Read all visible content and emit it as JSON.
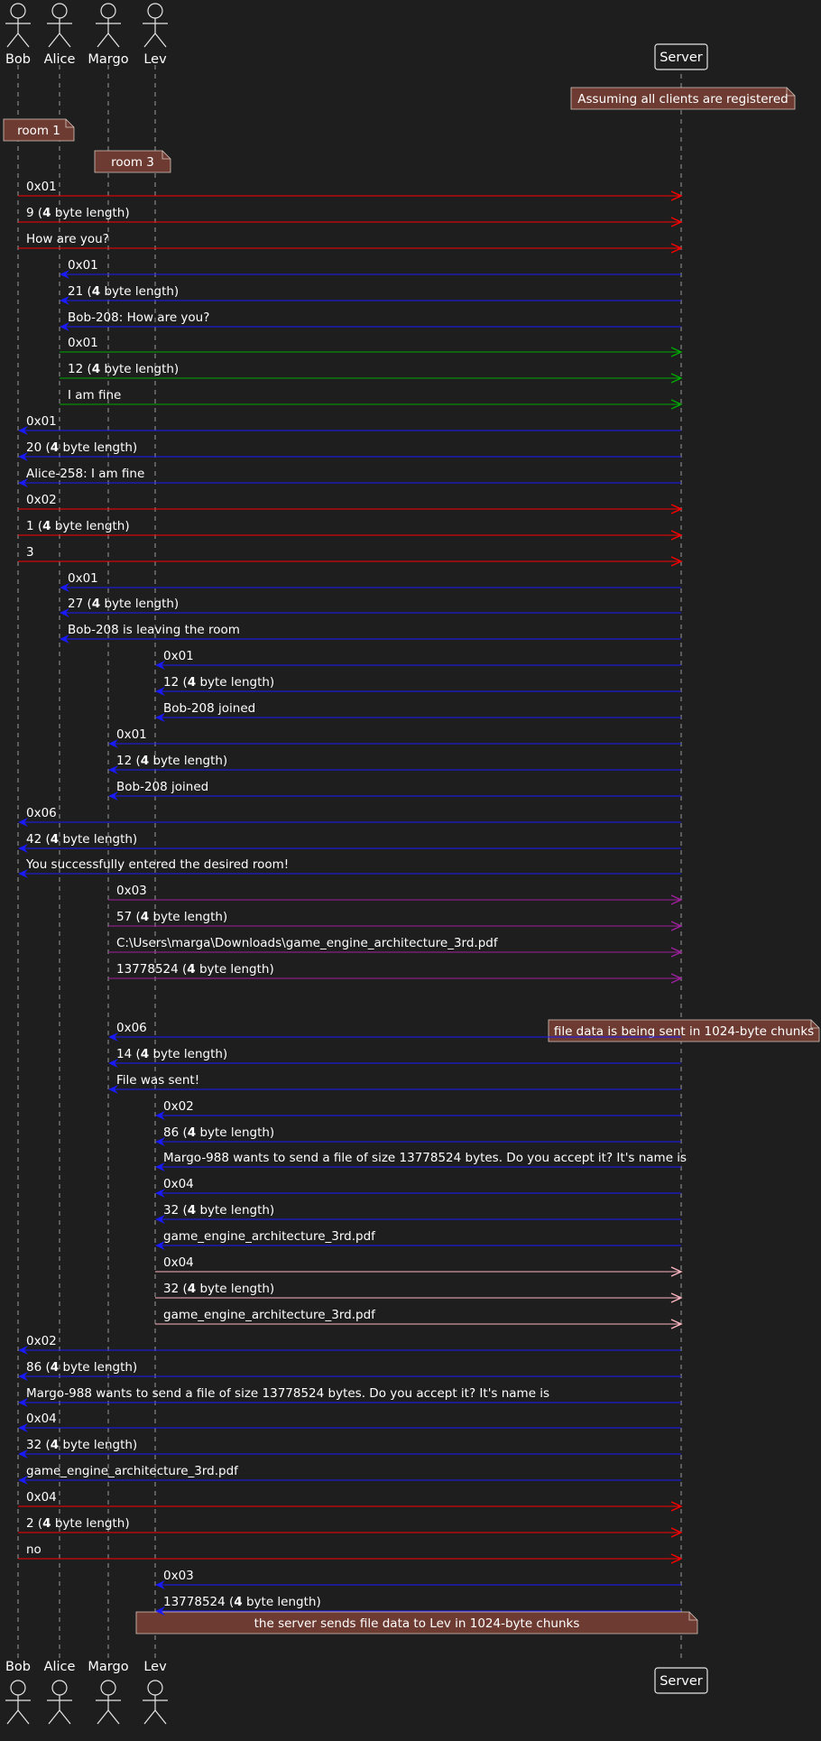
{
  "participants": [
    {
      "id": "bob",
      "name": "Bob",
      "kind": "actor"
    },
    {
      "id": "alice",
      "name": "Alice",
      "kind": "actor"
    },
    {
      "id": "margo",
      "name": "Margo",
      "kind": "actor"
    },
    {
      "id": "lev",
      "name": "Lev",
      "kind": "actor"
    },
    {
      "id": "server",
      "name": "Server",
      "kind": "box"
    }
  ],
  "colors": {
    "background": "#1e1e1e",
    "lifeline": "#9a9a9a",
    "note_fill": "#6e3b32",
    "bob": "#ff0000",
    "alice": "#00aa00",
    "margo": "#a020a0",
    "lev": "#ffb6c1",
    "server": "#1a1aff"
  },
  "notes": [
    {
      "text": "Assuming all clients are registered",
      "over": "server",
      "after": -1
    },
    {
      "text": "room 1",
      "over": "bob",
      "after": -1
    },
    {
      "text": "room 3",
      "over": "margo",
      "after": -1
    },
    {
      "text": "file data is being sent in 1024-byte chunks",
      "over": "server",
      "after": 32
    },
    {
      "text": "the server sends file data to Lev in 1024-byte chunks",
      "over": "margo-server",
      "after": 59
    }
  ],
  "messages": [
    {
      "from": "bob",
      "to": "server",
      "text": "0x01"
    },
    {
      "from": "bob",
      "to": "server",
      "text": "9 (",
      "bold": "4",
      "suffix": " byte length)"
    },
    {
      "from": "bob",
      "to": "server",
      "text": "How are you?"
    },
    {
      "from": "server",
      "to": "alice",
      "text": "0x01"
    },
    {
      "from": "server",
      "to": "alice",
      "text": "21 (",
      "bold": "4",
      "suffix": " byte length)"
    },
    {
      "from": "server",
      "to": "alice",
      "text": "Bob-208: How are you?"
    },
    {
      "from": "alice",
      "to": "server",
      "text": "0x01"
    },
    {
      "from": "alice",
      "to": "server",
      "text": "12 (",
      "bold": "4",
      "suffix": " byte length)"
    },
    {
      "from": "alice",
      "to": "server",
      "text": "I am fine"
    },
    {
      "from": "server",
      "to": "bob",
      "text": "0x01"
    },
    {
      "from": "server",
      "to": "bob",
      "text": "20 (",
      "bold": "4",
      "suffix": " byte length)"
    },
    {
      "from": "server",
      "to": "bob",
      "text": "Alice-258: I am fine"
    },
    {
      "from": "bob",
      "to": "server",
      "text": "0x02"
    },
    {
      "from": "bob",
      "to": "server",
      "text": "1 (",
      "bold": "4",
      "suffix": " byte length)"
    },
    {
      "from": "bob",
      "to": "server",
      "text": "3"
    },
    {
      "from": "server",
      "to": "alice",
      "text": "0x01"
    },
    {
      "from": "server",
      "to": "alice",
      "text": "27 (",
      "bold": "4",
      "suffix": " byte length)"
    },
    {
      "from": "server",
      "to": "alice",
      "text": "Bob-208 is leaving the room"
    },
    {
      "from": "server",
      "to": "lev",
      "text": "0x01"
    },
    {
      "from": "server",
      "to": "lev",
      "text": "12 (",
      "bold": "4",
      "suffix": " byte length)"
    },
    {
      "from": "server",
      "to": "lev",
      "text": "Bob-208 joined"
    },
    {
      "from": "server",
      "to": "margo",
      "text": "0x01"
    },
    {
      "from": "server",
      "to": "margo",
      "text": "12 (",
      "bold": "4",
      "suffix": " byte length)"
    },
    {
      "from": "server",
      "to": "margo",
      "text": "Bob-208 joined"
    },
    {
      "from": "server",
      "to": "bob",
      "text": "0x06"
    },
    {
      "from": "server",
      "to": "bob",
      "text": "42 (",
      "bold": "4",
      "suffix": " byte length)"
    },
    {
      "from": "server",
      "to": "bob",
      "text": "You successfully entered the desired room!"
    },
    {
      "from": "margo",
      "to": "server",
      "text": "0x03"
    },
    {
      "from": "margo",
      "to": "server",
      "text": "57 (",
      "bold": "4",
      "suffix": " byte length)"
    },
    {
      "from": "margo",
      "to": "server",
      "text": "C:\\Users\\marga\\Downloads\\game_engine_architecture_3rd.pdf"
    },
    {
      "from": "margo",
      "to": "server",
      "text": "13778524 (",
      "bold": "4",
      "suffix": " byte length)"
    },
    {
      "from": "server",
      "to": "margo",
      "text": "0x06"
    },
    {
      "from": "server",
      "to": "margo",
      "text": "14 (",
      "bold": "4",
      "suffix": " byte length)"
    },
    {
      "from": "server",
      "to": "margo",
      "text": "File was sent!"
    },
    {
      "from": "server",
      "to": "lev",
      "text": "0x02"
    },
    {
      "from": "server",
      "to": "lev",
      "text": "86 (",
      "bold": "4",
      "suffix": " byte length)"
    },
    {
      "from": "server",
      "to": "lev",
      "text": "Margo-988 wants to send a file of size 13778524 bytes. Do you accept it? It's name is"
    },
    {
      "from": "server",
      "to": "lev",
      "text": "0x04"
    },
    {
      "from": "server",
      "to": "lev",
      "text": "32 (",
      "bold": "4",
      "suffix": " byte length)"
    },
    {
      "from": "server",
      "to": "lev",
      "text": "game_engine_architecture_3rd.pdf"
    },
    {
      "from": "lev",
      "to": "server",
      "text": "0x04"
    },
    {
      "from": "lev",
      "to": "server",
      "text": "32 (",
      "bold": "4",
      "suffix": " byte length)"
    },
    {
      "from": "lev",
      "to": "server",
      "text": "game_engine_architecture_3rd.pdf"
    },
    {
      "from": "server",
      "to": "bob",
      "text": "0x02"
    },
    {
      "from": "server",
      "to": "bob",
      "text": "86 (",
      "bold": "4",
      "suffix": " byte length)"
    },
    {
      "from": "server",
      "to": "bob",
      "text": "Margo-988 wants to send a file of size 13778524 bytes. Do you accept it? It's name is"
    },
    {
      "from": "server",
      "to": "bob",
      "text": "0x04"
    },
    {
      "from": "server",
      "to": "bob",
      "text": "32 (",
      "bold": "4",
      "suffix": " byte length)"
    },
    {
      "from": "server",
      "to": "bob",
      "text": "game_engine_architecture_3rd.pdf"
    },
    {
      "from": "bob",
      "to": "server",
      "text": "0x04"
    },
    {
      "from": "bob",
      "to": "server",
      "text": "2 (",
      "bold": "4",
      "suffix": " byte length)"
    },
    {
      "from": "bob",
      "to": "server",
      "text": "no"
    },
    {
      "from": "server",
      "to": "lev",
      "text": "0x03"
    },
    {
      "from": "server",
      "to": "lev",
      "text": "13778524 (",
      "bold": "4",
      "suffix": " byte length)"
    }
  ]
}
